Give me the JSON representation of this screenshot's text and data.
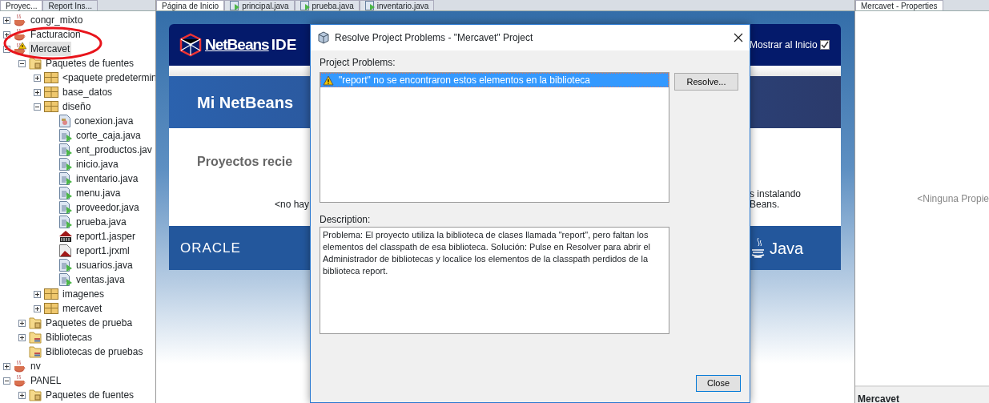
{
  "left_tabs": [
    {
      "label": "Proyec...",
      "selected": true
    },
    {
      "label": "Report Ins...",
      "selected": false
    }
  ],
  "editor_tabs": [
    {
      "label": "Página de Inicio",
      "selected": true,
      "kind": "page"
    },
    {
      "label": "principal.java",
      "selected": false,
      "kind": "java"
    },
    {
      "label": "prueba.java",
      "selected": false,
      "kind": "java"
    },
    {
      "label": "inventario.java",
      "selected": false,
      "kind": "java"
    }
  ],
  "right_tabs": [
    {
      "label": "Mercavet - Properties",
      "selected": true
    }
  ],
  "project_tree": [
    {
      "label": "congr_mixto",
      "kind": "project",
      "expanded": false,
      "selected": false
    },
    {
      "label": "Facturacion",
      "kind": "project",
      "expanded": false,
      "selected": false
    },
    {
      "label": "Mercavet",
      "kind": "project",
      "expanded": true,
      "selected": true,
      "warning": true,
      "children": [
        {
          "label": "Paquetes de fuentes",
          "kind": "source-folder",
          "expanded": true,
          "selected": false,
          "children": [
            {
              "label": "<paquete predetermin",
              "kind": "package",
              "expanded": false,
              "selected": false
            },
            {
              "label": "base_datos",
              "kind": "package",
              "expanded": false,
              "selected": false
            },
            {
              "label": "diseño",
              "kind": "package",
              "expanded": true,
              "selected": false,
              "children": [
                {
                  "label": "conexion.java",
                  "kind": "class",
                  "selected": false
                },
                {
                  "label": "corte_caja.java",
                  "kind": "form",
                  "selected": false
                },
                {
                  "label": "ent_productos.jav",
                  "kind": "form",
                  "selected": false
                },
                {
                  "label": "inicio.java",
                  "kind": "form",
                  "selected": false
                },
                {
                  "label": "inventario.java",
                  "kind": "form",
                  "selected": false
                },
                {
                  "label": "menu.java",
                  "kind": "form",
                  "selected": false
                },
                {
                  "label": "proveedor.java",
                  "kind": "form",
                  "selected": false
                },
                {
                  "label": "prueba.java",
                  "kind": "form",
                  "selected": false
                },
                {
                  "label": "report1.jasper",
                  "kind": "jasper",
                  "selected": false
                },
                {
                  "label": "report1.jrxml",
                  "kind": "jrxml",
                  "selected": false
                },
                {
                  "label": "usuarios.java",
                  "kind": "form",
                  "selected": false
                },
                {
                  "label": "ventas.java",
                  "kind": "form",
                  "selected": false
                }
              ]
            },
            {
              "label": "imagenes",
              "kind": "package",
              "expanded": false,
              "selected": false
            },
            {
              "label": "mercavet",
              "kind": "package",
              "expanded": false,
              "selected": false
            }
          ]
        },
        {
          "label": "Paquetes de prueba",
          "kind": "source-folder",
          "expanded": false,
          "selected": false
        },
        {
          "label": "Bibliotecas",
          "kind": "library",
          "expanded": false,
          "selected": false
        },
        {
          "label": "Bibliotecas de pruebas",
          "kind": "library",
          "selected": false
        }
      ]
    },
    {
      "label": "nv",
      "kind": "project",
      "expanded": false,
      "selected": false
    },
    {
      "label": "PANEL",
      "kind": "project",
      "expanded": true,
      "selected": false,
      "children": [
        {
          "label": "Paquetes de fuentes",
          "kind": "source-folder",
          "expanded": false,
          "selected": false
        }
      ]
    }
  ],
  "start_page": {
    "logo": {
      "name": "NetBeans",
      "suffix": "IDE"
    },
    "show_on_startup": {
      "label": "Mostrar al Inicio",
      "checked": true
    },
    "banner_title": "Mi NetBeans",
    "recent_heading": "Proyectos recie",
    "recent_empty": "<no hay",
    "right_text": [
      "s instalando",
      "Beans."
    ],
    "footer_left": "ORACLE",
    "footer_right": "Java"
  },
  "properties": {
    "empty_text": "<Ninguna Propie",
    "footer_title": "Mercavet"
  },
  "dialog": {
    "title": "Resolve Project Problems - \"Mercavet\" Project",
    "problems_label": "Project Problems:",
    "problems": [
      {
        "text": "\"report\" no se encontraron estos elementos en la biblioteca",
        "selected": true
      }
    ],
    "resolve_button": "Resolve...",
    "description_label": "Description:",
    "description": "Problema: El proyecto utiliza la biblioteca de clases llamada \"report\", pero faltan los elementos del classpath de esa biblioteca. Solución: Pulse en Resolver para abrir el Administrador de bibliotecas y localice los elementos de la classpath perdidos de la biblioteca report.",
    "close_button": "Close"
  }
}
